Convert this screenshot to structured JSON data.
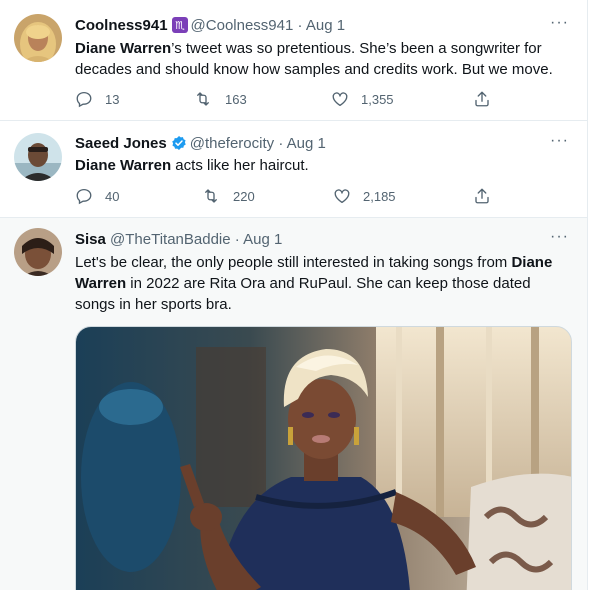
{
  "tweets": [
    {
      "name": "Coolness941",
      "handle": "@Coolness941",
      "dot": "·",
      "date": "Aug 1",
      "badge_icon": "scorpio-zodiac-badge-icon",
      "text_bold": "Diane Warren",
      "text_rest": "’s tweet was so pretentious. She’s been a songwriter for decades and should know how samples and credits work. But we move.",
      "more": "···",
      "replies": "13",
      "retweets": "163",
      "likes": "1,355"
    },
    {
      "name": "Saeed Jones",
      "handle": "@theferocity",
      "dot": "·",
      "date": "Aug 1",
      "badge_icon": "verified-badge-icon",
      "text_bold": "Diane Warren",
      "text_rest": " acts like her haircut.",
      "more": "···",
      "replies": "40",
      "retweets": "220",
      "likes": "2,185"
    },
    {
      "name": "Sisa",
      "handle": "@TheTitanBaddie",
      "dot": "·",
      "date": "Aug 1",
      "text_pre": "Let's be clear, the only people still interested in taking songs from ",
      "text_bold": "Diane Warren",
      "text_rest": " in 2022 are Rita Ora and RuPaul. She can keep those dated songs in her sports bra.",
      "more": "···",
      "media_icon": "photo-woman-pointing"
    }
  ],
  "colors": {
    "secondary_text": "#536471",
    "verified_blue": "#1d9bf0",
    "zodiac_purple": "#7b3fb8",
    "divider": "#e6ecf0"
  }
}
